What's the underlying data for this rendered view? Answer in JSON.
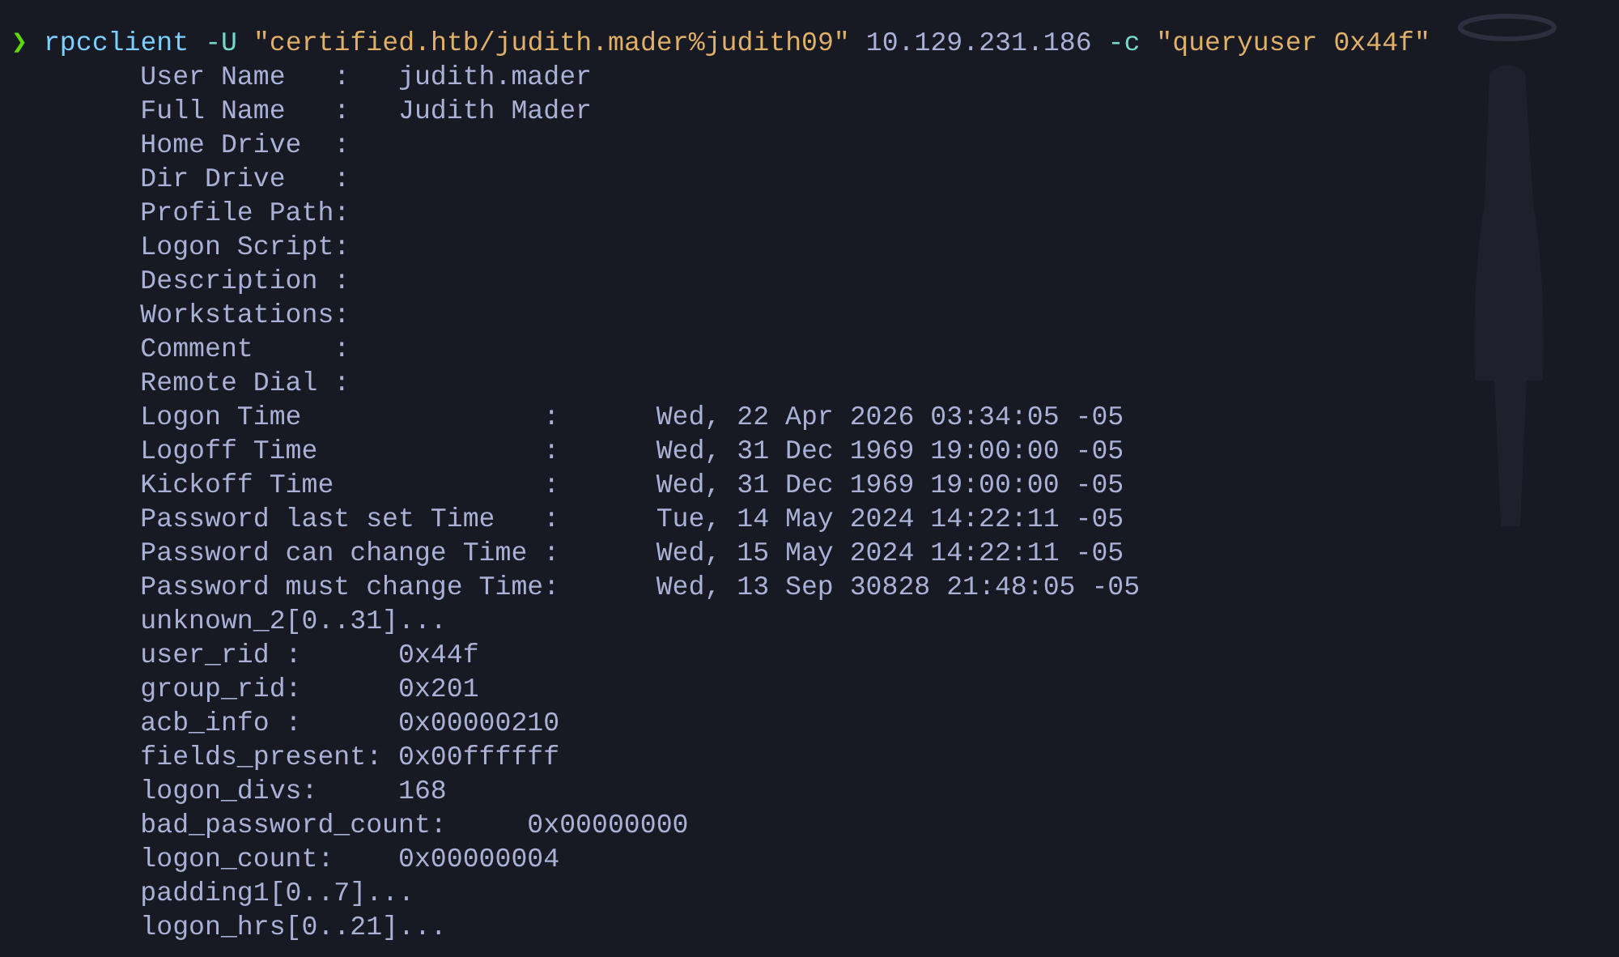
{
  "prompt": {
    "symbol": "❯"
  },
  "command": [
    {
      "kind": "program",
      "text": "rpcclient"
    },
    {
      "kind": "flag",
      "text": "-U"
    },
    {
      "kind": "string",
      "text": "\"certified.htb/judith.mader%judith09\""
    },
    {
      "kind": "arg",
      "text": "10.129.231.186"
    },
    {
      "kind": "flag",
      "text": "-c"
    },
    {
      "kind": "string",
      "text": "\"queryuser 0x44f\""
    }
  ],
  "output": [
    {
      "label": "User Name   :",
      "value": "judith.mader"
    },
    {
      "label": "Full Name   :",
      "value": "Judith Mader"
    },
    {
      "label": "Home Drive  :"
    },
    {
      "label": "Dir Drive   :"
    },
    {
      "label": "Profile Path:"
    },
    {
      "label": "Logon Script:"
    },
    {
      "label": "Description :"
    },
    {
      "label": "Workstations:"
    },
    {
      "label": "Comment     :"
    },
    {
      "label": "Remote Dial :"
    },
    {
      "label": "Logon Time               :",
      "value": "Wed, 22 Apr 2026 03:34:05 -05"
    },
    {
      "label": "Logoff Time              :",
      "value": "Wed, 31 Dec 1969 19:00:00 -05"
    },
    {
      "label": "Kickoff Time             :",
      "value": "Wed, 31 Dec 1969 19:00:00 -05"
    },
    {
      "label": "Password last set Time   :",
      "value": "Tue, 14 May 2024 14:22:11 -05"
    },
    {
      "label": "Password can change Time :",
      "value": "Wed, 15 May 2024 14:22:11 -05"
    },
    {
      "label": "Password must change Time:",
      "value": "Wed, 13 Sep 30828 21:48:05 -05"
    },
    {
      "label": "unknown_2[0..31]..."
    },
    {
      "label": "user_rid :",
      "value": "0x44f"
    },
    {
      "label": "group_rid:",
      "value": "0x201"
    },
    {
      "label": "acb_info :",
      "value": "0x00000210"
    },
    {
      "label": "fields_present:",
      "value": "0x00ffffff"
    },
    {
      "label": "logon_divs:",
      "value": "168"
    },
    {
      "label": "bad_password_count:",
      "value": "0x00000000"
    },
    {
      "label": "logon_count:",
      "value": "0x00000004"
    },
    {
      "label": "padding1[0..7]..."
    },
    {
      "label": "logon_hrs[0..21]..."
    }
  ]
}
